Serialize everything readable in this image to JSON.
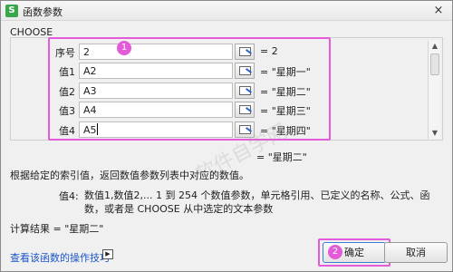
{
  "window": {
    "title": "函数参数",
    "app_icon": "S",
    "close_label": "×"
  },
  "function_name": "CHOOSE",
  "args": [
    {
      "label": "序号",
      "value": "2",
      "result": "= 2"
    },
    {
      "label": "值1",
      "value": "A2",
      "result": "= \"星期一\""
    },
    {
      "label": "值2",
      "value": "A3",
      "result": "= \"星期二\""
    },
    {
      "label": "值3",
      "value": "A4",
      "result": "= \"星期三\""
    },
    {
      "label": "值4",
      "value": "A5",
      "result": "= \"星期四\""
    }
  ],
  "function_result": "= \"星期二\"",
  "function_description": "根据给定的索引值，返回数值参数列表中对应的数值。",
  "arg_help": {
    "label": "值4:",
    "text": "数值1,数值2,... 1 到 254 个数值参数，单元格引用、已定义的名称、公式、函数，或者是 CHOOSE 从中选定的文本参数"
  },
  "calc_result": "计算结果 = \"星期二\"",
  "help_link": "查看该函数的操作技巧",
  "buttons": {
    "ok": "确定",
    "cancel": "取消"
  },
  "markers": {
    "one": "1",
    "two": "2"
  },
  "watermark": "软件自学网",
  "colors": {
    "highlight": "#e35bd8",
    "link": "#1a56c9"
  },
  "icons": {
    "video": "▶"
  }
}
